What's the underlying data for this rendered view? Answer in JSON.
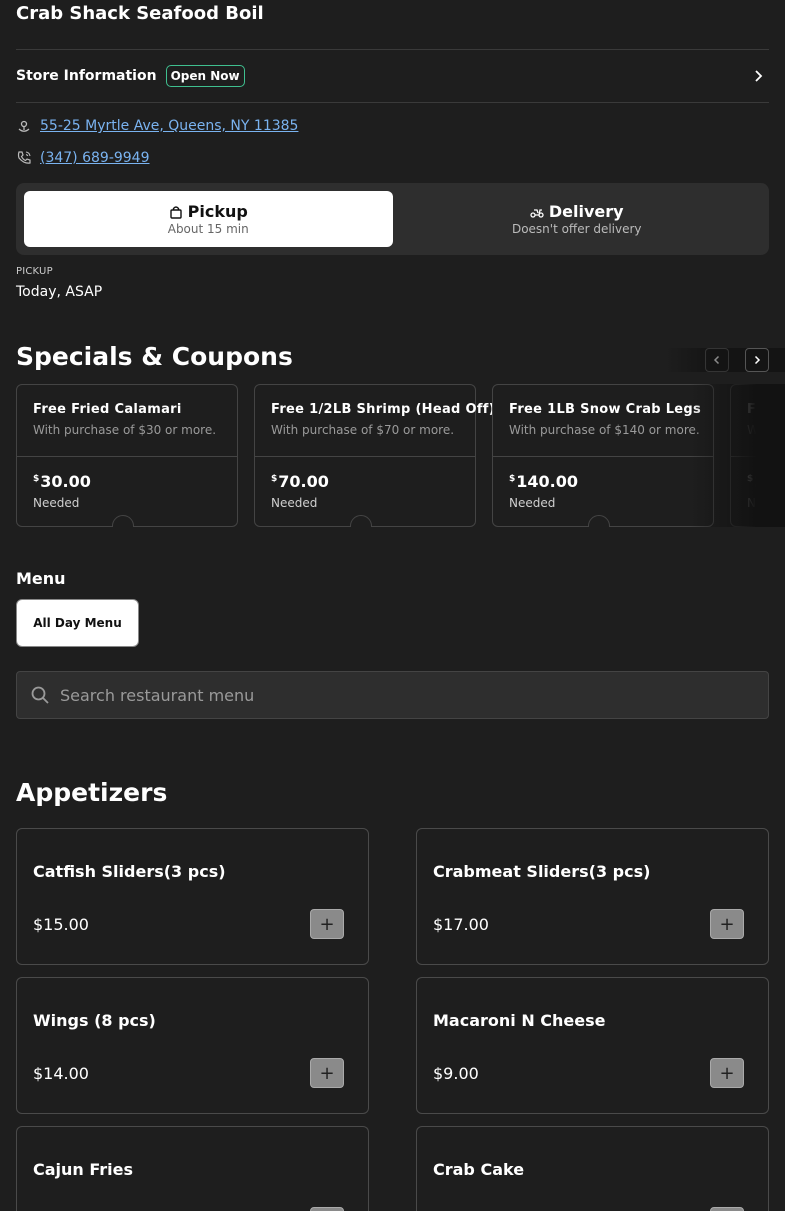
{
  "restaurant": {
    "name": "Crab Shack Seafood Boil",
    "store_info_label": "Store Information",
    "status_badge": "Open Now",
    "address": "55-25 Myrtle Ave, Queens, NY 11385",
    "phone": "(347) 689-9949"
  },
  "order_mode": {
    "pickup": {
      "label": "Pickup",
      "sub": "About 15 min",
      "active": true
    },
    "delivery": {
      "label": "Delivery",
      "sub": "Doesn't offer delivery",
      "active": false
    }
  },
  "pickup_time": {
    "label": "PICKUP",
    "value": "Today, ASAP"
  },
  "specials": {
    "heading": "Specials & Coupons",
    "coupons": [
      {
        "title": "Free Fried Calamari",
        "sub": "With purchase of $30 or more.",
        "currency": "$",
        "amount": "30.00",
        "needed": "Needed"
      },
      {
        "title": "Free 1/2LB Shrimp (Head Off)",
        "sub": "With purchase of $70 or more.",
        "currency": "$",
        "amount": "70.00",
        "needed": "Needed"
      },
      {
        "title": "Free 1LB Snow Crab Legs",
        "sub": "With purchase of $140 or more.",
        "currency": "$",
        "amount": "140.00",
        "needed": "Needed"
      },
      {
        "title": "Fr",
        "sub": "W",
        "currency": "$",
        "amount": "2",
        "needed": "Ne"
      }
    ]
  },
  "menu": {
    "heading": "Menu",
    "tab": "All Day Menu",
    "search_placeholder": "Search restaurant menu"
  },
  "appetizers": {
    "heading": "Appetizers",
    "items": [
      {
        "name": "Catfish Sliders(3 pcs)",
        "price": "$15.00"
      },
      {
        "name": "Crabmeat Sliders(3 pcs)",
        "price": "$17.00"
      },
      {
        "name": "Wings (8 pcs)",
        "price": "$14.00"
      },
      {
        "name": "Macaroni N Cheese",
        "price": "$9.00"
      },
      {
        "name": "Cajun Fries",
        "price": ""
      },
      {
        "name": "Crab Cake",
        "price": ""
      }
    ],
    "add_label": "+"
  },
  "icons": {
    "store_info_chevron": "chevron-right-icon",
    "address": "location-pin-icon",
    "phone": "phone-icon",
    "pickup": "shopping-bag-icon",
    "delivery": "scooter-icon",
    "search": "search-icon"
  },
  "colors": {
    "background": "#1e1e1e",
    "badge_border": "#3fbf8f",
    "link": "#7ab3f0"
  }
}
